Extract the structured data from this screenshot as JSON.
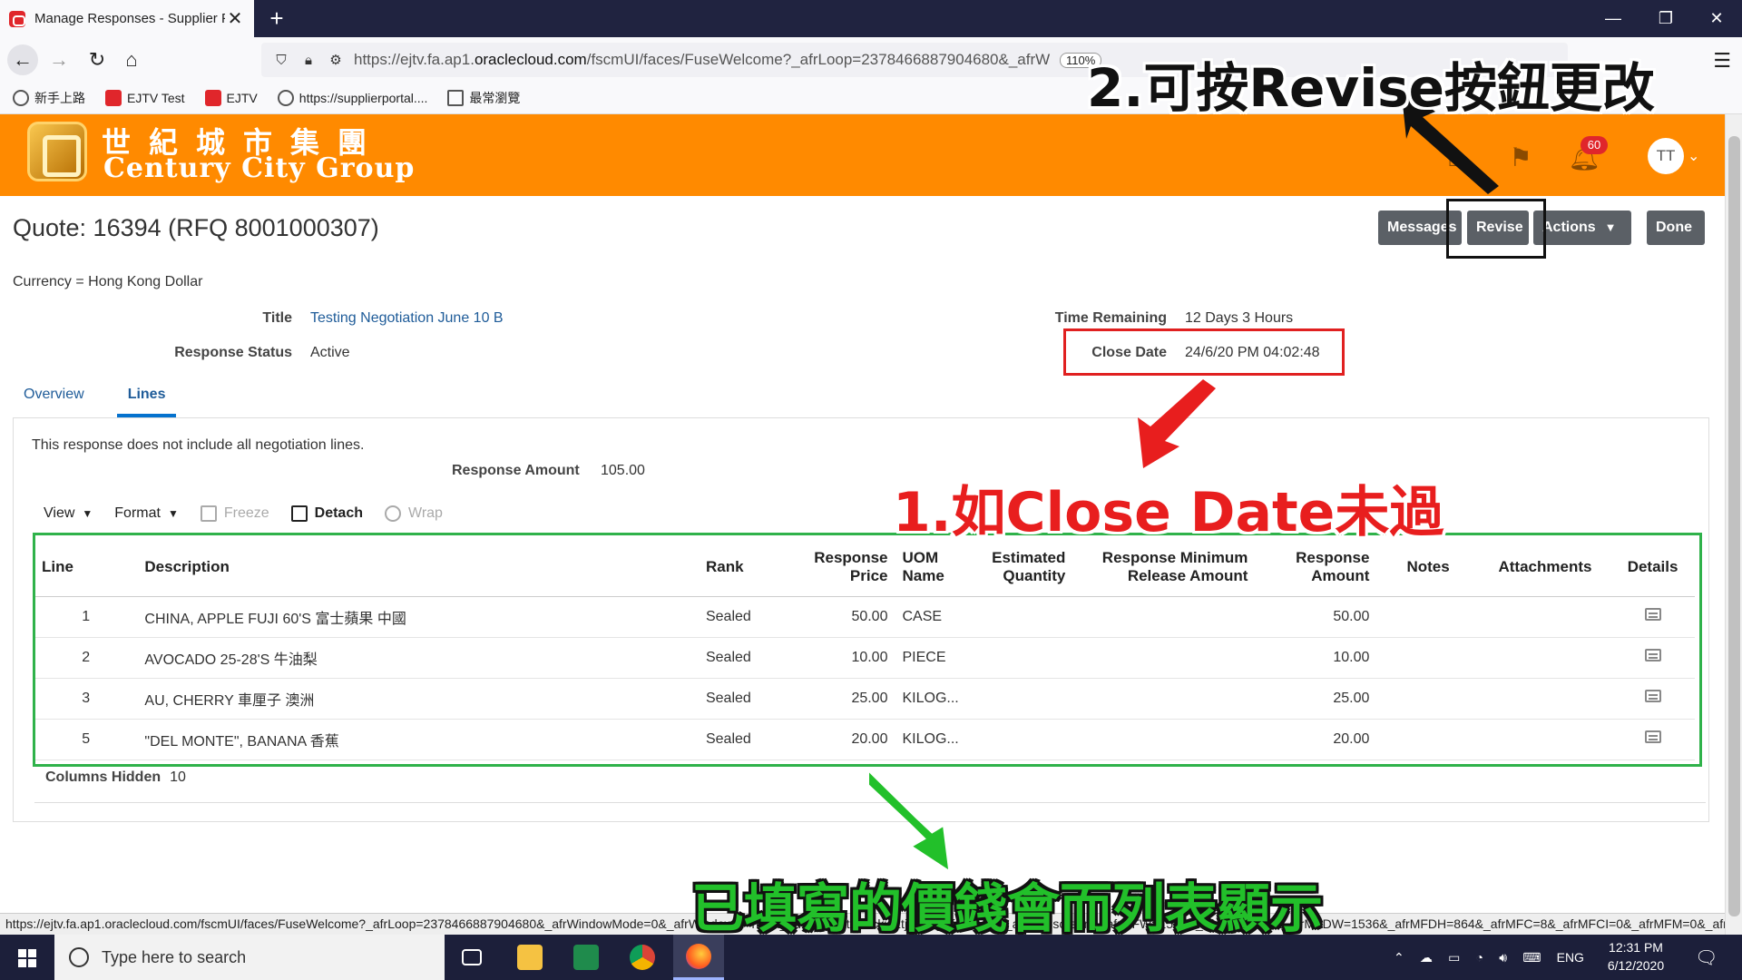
{
  "browser": {
    "tab_title": "Manage Responses - Supplier P",
    "tab_close": "✕",
    "new_tab": "+",
    "url_prefix": "https://ejtv.fa.ap1.",
    "url_domain": "oraclecloud.com",
    "url_rest": "/fscmUI/faces/FuseWelcome?_afrLoop=2378466887904680&_afrW",
    "zoom": "110%",
    "bookmarks": [
      "新手上路",
      "EJTV Test",
      "EJTV",
      "https://supplierportal....",
      "最常瀏覽"
    ],
    "status_url": "https://ejtv.fa.ap1.oraclecloud.com/fscmUI/faces/FuseWelcome?_afrLoop=2378466887904680&_afrWindowMode=0&_afrWindowId=null&_adf.ctrl-state=1ckjq2tj2_1&_afrFS=16&_afrMT=screen&_afrMFW=1536&_afrMFH=730&_afrMFDW=1536&_afrMFDH=864&_afrMFC=8&_afrMFCI=0&_afrMFM=0&_afrMFR=130&_afrMFG=0&_afrMFS=0&_afrMFO=0#"
  },
  "header": {
    "logo_cn": "世紀城市集團",
    "logo_en": "Century City Group",
    "notification_count": "60",
    "avatar_initials": "TT"
  },
  "page": {
    "title": "Quote: 16394 (RFQ 8001000307)",
    "currency": "Currency = Hong Kong Dollar",
    "buttons": {
      "messages": "Messages",
      "revise": "Revise",
      "actions": "Actions",
      "done": "Done"
    },
    "fields": {
      "title_label": "Title",
      "title_value": "Testing Negotiation June 10 B",
      "status_label": "Response Status",
      "status_value": "Active",
      "time_label": "Time Remaining",
      "time_value": "12 Days 3 Hours",
      "close_label": "Close Date",
      "close_value": "24/6/20 PM 04:02:48"
    },
    "tabs": [
      "Overview",
      "Lines"
    ],
    "note": "This response does not include all negotiation lines.",
    "response_amount_label": "Response Amount",
    "response_amount_value": "105.00",
    "toolbar": {
      "view": "View",
      "format": "Format",
      "freeze": "Freeze",
      "detach": "Detach",
      "wrap": "Wrap"
    },
    "table": {
      "headers": {
        "line": "Line",
        "description": "Description",
        "rank": "Rank",
        "response_price_1": "Response",
        "response_price_2": "Price",
        "uom_1": "UOM",
        "uom_2": "Name",
        "est_qty_1": "Estimated",
        "est_qty_2": "Quantity",
        "min_release_1": "Response Minimum",
        "min_release_2": "Release Amount",
        "response_amount_1": "Response",
        "response_amount_2": "Amount",
        "notes": "Notes",
        "attachments": "Attachments",
        "details": "Details"
      },
      "rows": [
        {
          "line": "1",
          "description": "CHINA, APPLE FUJI 60'S 富士蘋果 中國",
          "rank": "Sealed",
          "price": "50.00",
          "uom": "CASE",
          "amount": "50.00"
        },
        {
          "line": "2",
          "description": "AVOCADO 25-28'S 牛油梨",
          "rank": "Sealed",
          "price": "10.00",
          "uom": "PIECE",
          "amount": "10.00"
        },
        {
          "line": "3",
          "description": "AU, CHERRY 車厘子 澳洲",
          "rank": "Sealed",
          "price": "25.00",
          "uom": "KILOG...",
          "amount": "25.00"
        },
        {
          "line": "5",
          "description": "\"DEL MONTE\", BANANA 香蕉",
          "rank": "Sealed",
          "price": "20.00",
          "uom": "KILOG...",
          "amount": "20.00"
        }
      ]
    },
    "columns_hidden_label": "Columns Hidden",
    "columns_hidden_value": "10"
  },
  "annotations": {
    "top": "2.可按Revise按鈕更改",
    "red": "1.如Close Date未過",
    "green": "已填寫的價錢會而列表顯示"
  },
  "taskbar": {
    "search_placeholder": "Type here to search",
    "lang": "ENG",
    "time": "12:31 PM",
    "date": "6/12/2020"
  },
  "colors": {
    "brand_orange": "#ff8a00",
    "button_gray": "#5b6066",
    "link_blue": "#1f5c99",
    "annot_red": "#e02020",
    "annot_green": "#2fb24a"
  }
}
